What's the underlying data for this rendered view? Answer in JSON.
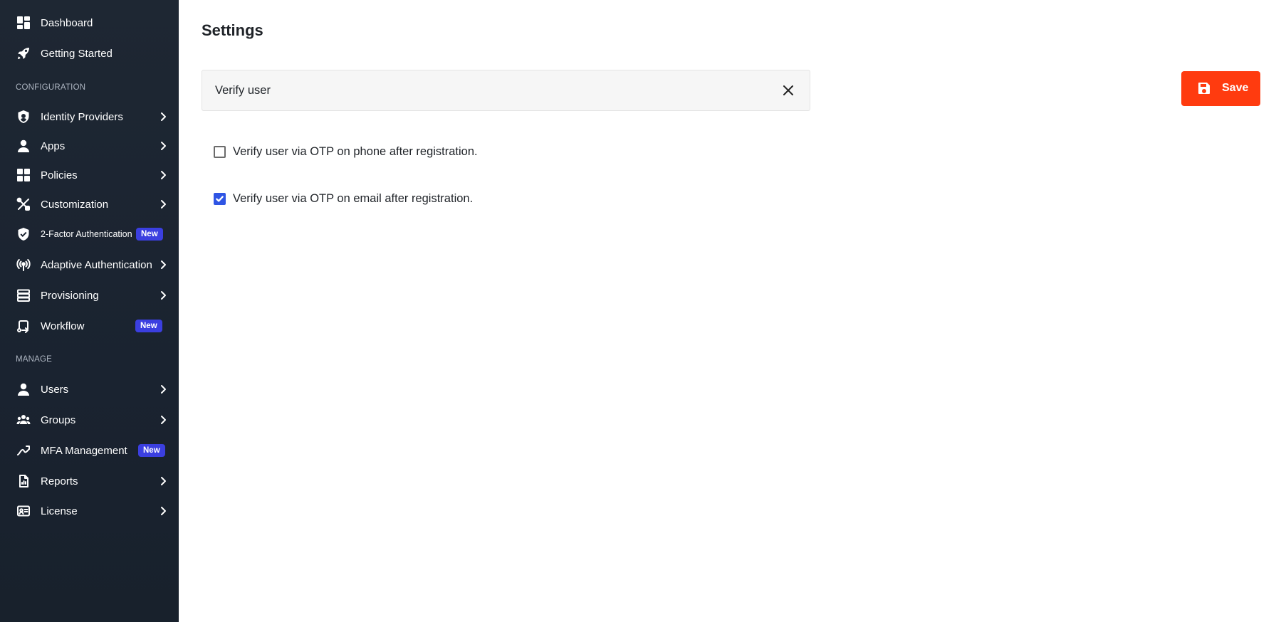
{
  "sidebar": {
    "items": [
      {
        "label": "Dashboard",
        "icon": "dashboard-icon",
        "chevron": false
      },
      {
        "label": "Getting Started",
        "icon": "rocket-icon",
        "chevron": false
      }
    ],
    "configuration_title": "CONFIGURATION",
    "configuration": [
      {
        "label": "Identity Providers",
        "icon": "shield-icon",
        "chevron": true
      },
      {
        "label": "Apps",
        "icon": "person-icon",
        "chevron": true
      },
      {
        "label": "Policies",
        "icon": "grid-icon",
        "chevron": true
      },
      {
        "label": "Customization",
        "icon": "tools-icon",
        "chevron": true
      },
      {
        "label": "2-Factor Authentication",
        "icon": "shield-check-icon",
        "chevron": false,
        "badge": "New"
      },
      {
        "label": "Adaptive Authentication",
        "icon": "broadcast-icon",
        "chevron": true
      },
      {
        "label": "Provisioning",
        "icon": "server-icon",
        "chevron": true
      },
      {
        "label": "Workflow",
        "icon": "workflow-icon",
        "chevron": false,
        "badge": "New"
      }
    ],
    "manage_title": "MANAGE",
    "manage": [
      {
        "label": "Users",
        "icon": "user-icon",
        "chevron": true
      },
      {
        "label": "Groups",
        "icon": "groups-icon",
        "chevron": true
      },
      {
        "label": "MFA Management",
        "icon": "mfa-icon",
        "chevron": false,
        "badge": "New"
      },
      {
        "label": "Reports",
        "icon": "report-icon",
        "chevron": true
      },
      {
        "label": "License",
        "icon": "license-icon",
        "chevron": true
      }
    ]
  },
  "main": {
    "title": "Settings",
    "search": {
      "value": "Verify user",
      "placeholder": ""
    },
    "save_label": "Save",
    "options": [
      {
        "label": "Verify user via OTP on phone after registration.",
        "checked": false
      },
      {
        "label": "Verify user via OTP on email after registration.",
        "checked": true
      }
    ]
  },
  "colors": {
    "sidebar_bg": "#1e2733",
    "accent": "#ff3b0f",
    "badge": "#3b3fe0",
    "checkbox_checked": "#2f55e4"
  }
}
